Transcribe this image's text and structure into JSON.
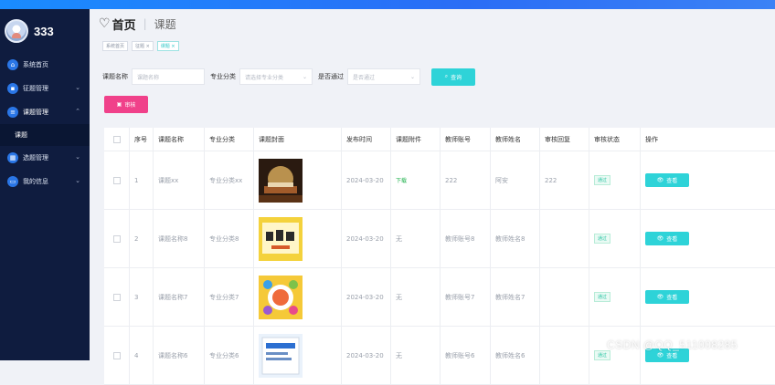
{
  "sidebar": {
    "username": "333",
    "items": [
      {
        "label": "系统首页",
        "icon": "home-icon",
        "has_chevron": false
      },
      {
        "label": "征题管理",
        "icon": "briefcase-icon",
        "has_chevron": true
      },
      {
        "label": "课题管理",
        "icon": "list-icon",
        "has_chevron": true
      },
      {
        "label": "选题管理",
        "icon": "grid-icon",
        "has_chevron": true
      },
      {
        "label": "我的信息",
        "icon": "card-icon",
        "has_chevron": true
      }
    ],
    "submenu_label": "课题"
  },
  "header": {
    "home": "首页",
    "crumb": "课题"
  },
  "tags": [
    "系统首页",
    "征题 ×",
    "课题 ×"
  ],
  "filter": {
    "label1": "课题名称",
    "placeholder1": "课题名称",
    "label2": "专业分类",
    "placeholder2": "请选择专业分类",
    "label3": "是否通过",
    "placeholder3": "是否通过",
    "search_label": "查询"
  },
  "audit_label": "审核",
  "table": {
    "headers": [
      "",
      "序号",
      "课题名称",
      "专业分类",
      "课题封面",
      "发布时间",
      "课题附件",
      "教师账号",
      "教师姓名",
      "审核回复",
      "审核状态",
      "操作"
    ],
    "rows": [
      {
        "no": "1",
        "name": "课题xx",
        "category": "专业分类xx",
        "cover": "books",
        "time": "2024-03-20",
        "attachment": "下载",
        "account": "222",
        "teacher": "阿安",
        "reply": "222",
        "status": "通过",
        "action": "查看"
      },
      {
        "no": "2",
        "name": "课题名称8",
        "category": "专业分类8",
        "cover": "yellow-book",
        "time": "2024-03-20",
        "attachment": "无",
        "account": "教师账号8",
        "teacher": "教师姓名8",
        "reply": "",
        "status": "通过",
        "action": "查看"
      },
      {
        "no": "3",
        "name": "课题名称7",
        "category": "专业分类7",
        "cover": "chart",
        "time": "2024-03-20",
        "attachment": "无",
        "account": "教师账号7",
        "teacher": "教师姓名7",
        "reply": "",
        "status": "通过",
        "action": "查看"
      },
      {
        "no": "4",
        "name": "课题名称6",
        "category": "专业分类6",
        "cover": "blue-cover",
        "time": "2024-03-20",
        "attachment": "无",
        "account": "教师账号6",
        "teacher": "教师姓名6",
        "reply": "",
        "status": "通过",
        "action": "查看"
      }
    ]
  },
  "watermark": "CSDN @QQ_511008285"
}
